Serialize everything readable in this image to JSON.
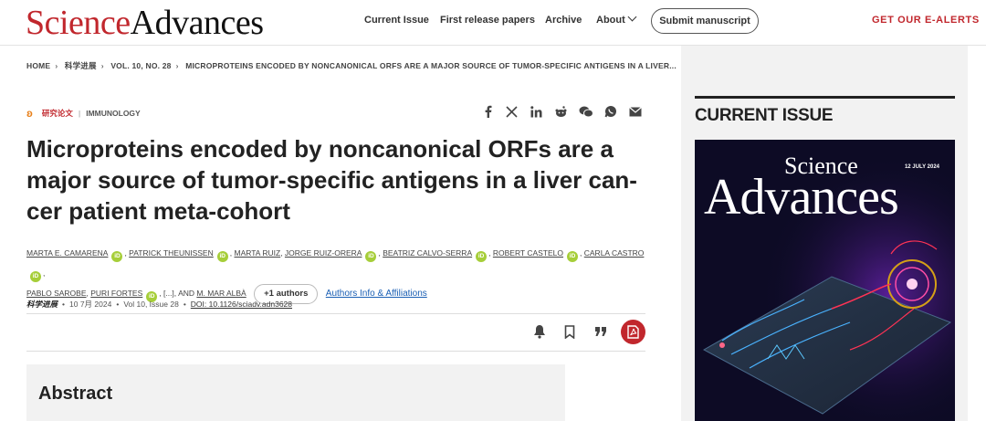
{
  "header": {
    "logo_science": "Science",
    "logo_advances": "Advances",
    "nav": [
      "Current Issue",
      "First release papers",
      "Archive",
      "About"
    ],
    "submit_label": "Submit manuscript",
    "alerts_label": "GET OUR E-ALERTS"
  },
  "breadcrumb": [
    "HOME",
    "科学进展",
    "VOL. 10, NO. 28",
    "MICROPROTEINS ENCODED BY NONCANONICAL ORFS ARE A MAJOR SOURCE OF TUMOR-SPECIFIC ANTIGENS IN A LIVER..."
  ],
  "article": {
    "category_primary": "研究论文",
    "category_separator": "|",
    "category_secondary": "IMMUNOLOGY",
    "title": "Microproteins encoded by noncanonical ORFs are a major source of tumor-specific antigens in a liver can-cer patient meta-cohort",
    "authors": [
      "MARTA E. CAMARENA",
      "PATRICK THEUNISSEN",
      "MARTA RUIZ",
      "JORGE RUIZ-ORERA",
      "BEATRIZ CALVO-SERRA",
      "ROBERT CASTELO",
      "CARLA CASTRO",
      "PABLO SAROBE",
      "PURI FORTES",
      "M. MAR ALBÀ"
    ],
    "ellipsis": "[...]",
    "and_text": "AND",
    "more_authors": "+1 authors",
    "affiliations_link": "Authors Info & Affiliations",
    "journal": "科学进展",
    "date": "10 7月 2024",
    "volume": "Vol 10, Issue 28",
    "doi": "DOI: 10.1126/sciadv.adn3628",
    "abstract_heading": "Abstract"
  },
  "share_icons": [
    "facebook-icon",
    "x-icon",
    "linkedin-icon",
    "reddit-icon",
    "wechat-icon",
    "whatsapp-icon",
    "email-icon"
  ],
  "tools": [
    "bell-icon",
    "bookmark-icon",
    "quote-icon",
    "pdf-icon"
  ],
  "sidebar": {
    "heading": "CURRENT ISSUE",
    "cover_title_line1": "Science",
    "cover_title_line2": "Advances",
    "cover_date": "12 JULY 2024"
  },
  "colors": {
    "brand_red": "#c1272d",
    "orcid_green": "#a6ce39",
    "link_blue": "#1a5fb4"
  }
}
